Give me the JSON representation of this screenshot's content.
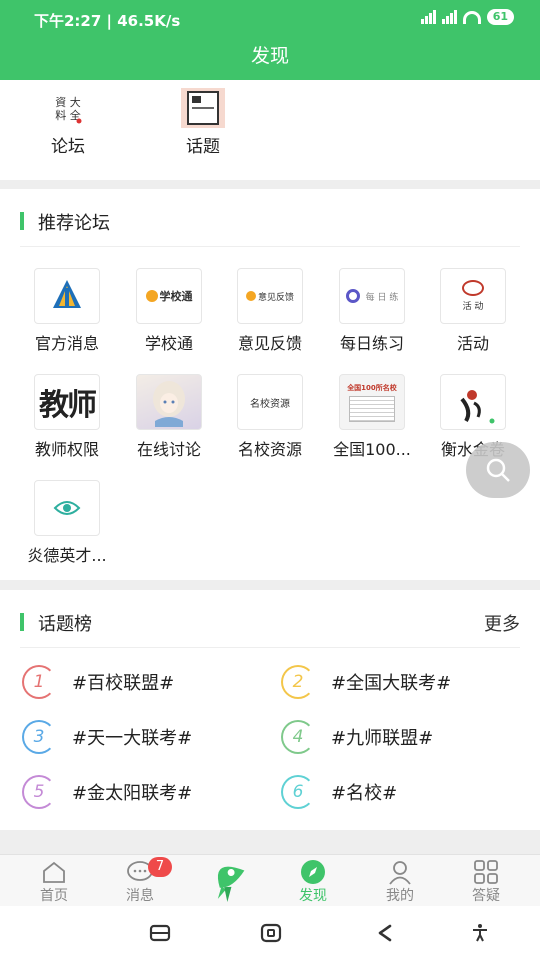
{
  "status": {
    "time_speed": "下午2:27 | 46.5K/s",
    "battery": "61"
  },
  "header": {
    "title": "发现"
  },
  "quick": [
    {
      "label": "论坛",
      "icon": "forum-calligraphy-icon"
    },
    {
      "label": "话题",
      "icon": "topic-book-icon"
    }
  ],
  "forums": {
    "title": "推荐论坛",
    "items": [
      {
        "label": "官方消息",
        "icon": "official-logo-icon"
      },
      {
        "label": "学校通",
        "icon": "school-tong-icon",
        "tile_text": "学校通"
      },
      {
        "label": "意见反馈",
        "icon": "feedback-icon",
        "tile_text": "意见反馈"
      },
      {
        "label": "每日练习",
        "icon": "daily-practice-icon",
        "tile_text": "每 日 练"
      },
      {
        "label": "活动",
        "icon": "activity-icon",
        "tile_text": "活  动"
      },
      {
        "label": "教师权限",
        "icon": "teacher-icon",
        "tile_text": "教师"
      },
      {
        "label": "在线讨论",
        "icon": "anime-girl-icon"
      },
      {
        "label": "名校资源",
        "icon": "famous-school-icon",
        "tile_text": "名校资源"
      },
      {
        "label": "全国100...",
        "icon": "national-100-icon",
        "tile_text": "全国100所名校"
      },
      {
        "label": "衡水金卷",
        "icon": "hengshui-icon"
      },
      {
        "label": "炎德英才...",
        "icon": "yande-icon"
      }
    ]
  },
  "topics": {
    "title": "话题榜",
    "more": "更多",
    "items": [
      {
        "num": "1",
        "name": "#百校联盟#",
        "color": "#e57373"
      },
      {
        "num": "2",
        "name": "#全国大联考#",
        "color": "#f3c64a"
      },
      {
        "num": "3",
        "name": "#天一大联考#",
        "color": "#5aa9e6"
      },
      {
        "num": "4",
        "name": "#九师联盟#",
        "color": "#7fc98b"
      },
      {
        "num": "5",
        "name": "#金太阳联考#",
        "color": "#c48ad6"
      },
      {
        "num": "6",
        "name": "#名校#",
        "color": "#5fd1d4"
      }
    ]
  },
  "tabs": [
    {
      "label": "首页",
      "icon": "home-icon"
    },
    {
      "label": "消息",
      "icon": "message-icon",
      "badge": "7"
    },
    {
      "label": "",
      "icon": "rocket-icon"
    },
    {
      "label": "发现",
      "icon": "discover-compass-icon"
    },
    {
      "label": "我的",
      "icon": "profile-icon"
    },
    {
      "label": "答疑",
      "icon": "grid-qa-icon"
    }
  ],
  "colors": {
    "accent": "#3fc46a",
    "badge": "#ef4a4a"
  }
}
